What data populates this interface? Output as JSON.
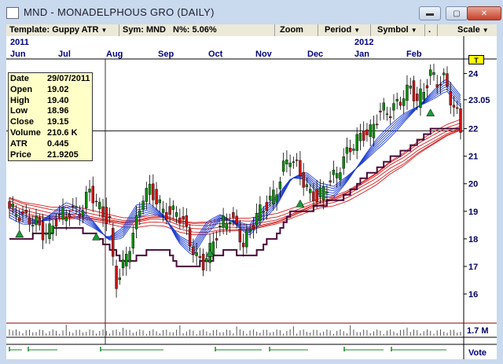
{
  "window": {
    "title": "MND - MONADELPHOUS GRO (DAILY)",
    "minimize_label": "▬",
    "maximize_label": "▢",
    "close_label": "✕"
  },
  "toolbar": {
    "template": "Template: Guppy ATR",
    "symbol": "Sym: MND",
    "percent": "N%: 5.06%",
    "zoom": "Zoom",
    "period": "Period",
    "symbol_menu": "Symbol",
    "dot": ".",
    "scale": "Scale"
  },
  "years": [
    "2011",
    "2012"
  ],
  "months": [
    "Jun",
    "Jul",
    "Aug",
    "Sep",
    "Oct",
    "Nov",
    "Dec",
    "Jan",
    "Feb"
  ],
  "price_ticks": [
    "24",
    "23.05",
    "22",
    "21",
    "20",
    "19",
    "18",
    "17",
    "16"
  ],
  "volume_label": "1.7 M",
  "vote_label": "Vote",
  "t_flag": "T",
  "info": [
    {
      "k": "Date",
      "v": "29/07/2011"
    },
    {
      "k": "Open",
      "v": "19.02"
    },
    {
      "k": "High",
      "v": "19.40"
    },
    {
      "k": "Low",
      "v": "18.96"
    },
    {
      "k": "Close",
      "v": "19.15"
    },
    {
      "k": "Volume",
      "v": "210.6 K"
    },
    {
      "k": "ATR",
      "v": "0.445"
    },
    {
      "k": "Price",
      "v": "21.9205"
    }
  ],
  "chart_data": {
    "type": "line",
    "title": "MND - MONADELPHOUS GRO (DAILY)",
    "close_path": [
      [
        0,
        19.1
      ],
      [
        4,
        18.8
      ],
      [
        8,
        18.6
      ],
      [
        10,
        18.2
      ],
      [
        12,
        18.3
      ],
      [
        14,
        18.7
      ],
      [
        16,
        18.9
      ],
      [
        19,
        19.0
      ],
      [
        22,
        19.1
      ],
      [
        24,
        19.8
      ],
      [
        26,
        19.3
      ],
      [
        28,
        18.9
      ],
      [
        30,
        18.6
      ],
      [
        31,
        17.2
      ],
      [
        32,
        16.4
      ],
      [
        34,
        17.0
      ],
      [
        36,
        17.8
      ],
      [
        38,
        18.6
      ],
      [
        40,
        19.6
      ],
      [
        42,
        19.8
      ],
      [
        44,
        19.4
      ],
      [
        46,
        19.0
      ],
      [
        48,
        18.9
      ],
      [
        50,
        19.0
      ],
      [
        52,
        18.6
      ],
      [
        54,
        17.9
      ],
      [
        56,
        17.3
      ],
      [
        58,
        17.1
      ],
      [
        60,
        17.6
      ],
      [
        62,
        18.2
      ],
      [
        64,
        18.6
      ],
      [
        66,
        18.8
      ],
      [
        68,
        18.4
      ],
      [
        70,
        17.8
      ],
      [
        72,
        18.3
      ],
      [
        74,
        18.9
      ],
      [
        76,
        19.1
      ],
      [
        78,
        19.4
      ],
      [
        80,
        19.8
      ],
      [
        82,
        20.6
      ],
      [
        84,
        21.0
      ],
      [
        86,
        20.6
      ],
      [
        88,
        20.1
      ],
      [
        90,
        19.6
      ],
      [
        92,
        19.5
      ],
      [
        94,
        19.8
      ],
      [
        96,
        20.1
      ],
      [
        98,
        20.4
      ],
      [
        100,
        20.9
      ],
      [
        102,
        21.3
      ],
      [
        104,
        21.6
      ],
      [
        106,
        21.8
      ],
      [
        108,
        21.9
      ],
      [
        110,
        22.4
      ],
      [
        112,
        22.7
      ],
      [
        114,
        22.6
      ],
      [
        116,
        22.9
      ],
      [
        118,
        23.2
      ],
      [
        120,
        23.5
      ],
      [
        122,
        23.0
      ],
      [
        124,
        23.4
      ],
      [
        126,
        24.0
      ],
      [
        128,
        23.7
      ],
      [
        130,
        23.8
      ],
      [
        132,
        23.1
      ],
      [
        134,
        22.5
      ],
      [
        135,
        21.9
      ]
    ],
    "short_term_ema": [
      19.0,
      18.7,
      18.6,
      18.8,
      19.1,
      18.9,
      18.5,
      18.0,
      18.2,
      19.0,
      19.1,
      18.8,
      18.0,
      17.6,
      18.4,
      18.8,
      18.6,
      18.3,
      18.9,
      19.4,
      20.2,
      20.3,
      19.8,
      19.7,
      20.2,
      20.8,
      21.4,
      21.9,
      22.4,
      22.8,
      23.2,
      23.6,
      23.0
    ],
    "long_term_ema": [
      19.5,
      19.3,
      19.2,
      19.1,
      19.1,
      19.1,
      19.0,
      18.9,
      18.8,
      18.8,
      18.9,
      18.9,
      18.7,
      18.6,
      18.6,
      18.7,
      18.7,
      18.7,
      18.8,
      18.9,
      19.1,
      19.3,
      19.5,
      19.6,
      19.8,
      20.1,
      20.4,
      20.8,
      21.1,
      21.5,
      21.8,
      22.1,
      22.3
    ],
    "atr_stop": [
      18.0,
      18.0,
      18.2,
      18.3,
      18.3,
      18.3,
      18.1,
      17.7,
      17.2,
      17.3,
      17.6,
      17.6,
      17.0,
      17.0,
      17.2,
      17.5,
      17.5,
      17.3,
      17.8,
      18.2,
      19.0,
      19.0,
      19.2,
      19.4,
      19.6,
      20.2,
      20.5,
      21.0,
      21.2,
      21.6,
      22.0,
      22.0,
      22.0
    ],
    "ylim": [
      15.0,
      24.5
    ],
    "crosshair_price": 21.9205
  }
}
